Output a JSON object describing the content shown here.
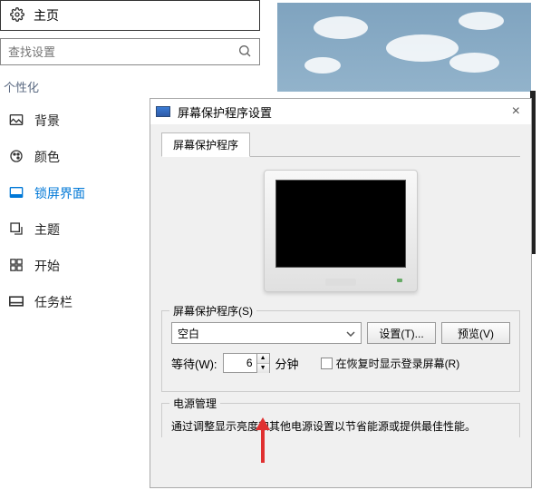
{
  "header": {
    "title": "主页"
  },
  "search": {
    "placeholder": "查找设置"
  },
  "section_label": "个性化",
  "sidebar": {
    "items": [
      {
        "label": "背景"
      },
      {
        "label": "颜色"
      },
      {
        "label": "锁屏界面"
      },
      {
        "label": "主题"
      },
      {
        "label": "开始"
      },
      {
        "label": "任务栏"
      }
    ]
  },
  "dialog": {
    "title": "屏幕保护程序设置",
    "tab": "屏幕保护程序",
    "group": {
      "title": "屏幕保护程序(S)",
      "saver": "空白",
      "settings_btn": "设置(T)...",
      "preview_btn": "预览(V)",
      "wait_label": "等待(W):",
      "wait_value": "6",
      "minutes": "分钟",
      "resume_chk": "在恢复时显示登录屏幕(R)"
    },
    "power": {
      "title": "电源管理",
      "text": "通过调整显示亮度和其他电源设置以节省能源或提供最佳性能。"
    }
  }
}
